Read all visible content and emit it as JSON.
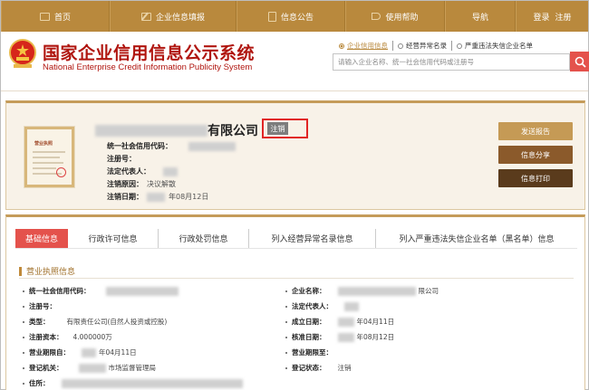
{
  "nav": {
    "home": "首页",
    "report": "企业信息填报",
    "notice": "信息公告",
    "help": "使用帮助",
    "guide": "导航",
    "login": "登录",
    "register": "注册"
  },
  "header": {
    "title_cn": "国家企业信用信息公示系统",
    "title_en": "National Enterprise Credit Information Publicity System",
    "links": {
      "enterprise_info": "企业信用信息",
      "abnormal_list": "经营异常名录",
      "blacklist": "严重违法失信企业名单"
    },
    "search_placeholder": "请输入企业名称、统一社会信用代码或注册号"
  },
  "company": {
    "name_suffix": "有限公司",
    "status": "注销",
    "license_title": "营业执照",
    "fields": {
      "credit_code_label": "统一社会信用代码：",
      "reg_no_label": "注册号：",
      "legal_rep_label": "法定代表人：",
      "cancel_reason_label": "注销原因：",
      "cancel_reason_value": "决议解散",
      "cancel_date_label": "注销日期：",
      "cancel_date_value": "年08月12日"
    },
    "buttons": {
      "send_report": "发送报告",
      "share": "信息分享",
      "print": "信息打印"
    }
  },
  "tabs": [
    {
      "label": "基础信息",
      "active": true
    },
    {
      "label": "行政许可信息"
    },
    {
      "label": "行政处罚信息"
    },
    {
      "label": "列入经营异常名录信息"
    },
    {
      "label": "列入严重违法失信企业名单（黑名单）信息"
    }
  ],
  "license_section": {
    "title": "营业执照信息",
    "left": [
      {
        "label": "统一社会信用代码：",
        "value": ""
      },
      {
        "label": "注册号：",
        "value": ""
      },
      {
        "label": "类型：",
        "value": "有限责任公司(自然人投资或控股)"
      },
      {
        "label": "注册资本：",
        "value": "4.000000万"
      },
      {
        "label": "营业期限自：",
        "value": "年04月11日"
      },
      {
        "label": "登记机关：",
        "value": "市场监督管理局"
      },
      {
        "label": "住所：",
        "value": ""
      }
    ],
    "right": [
      {
        "label": "企业名称：",
        "value": "限公司"
      },
      {
        "label": "法定代表人：",
        "value": ""
      },
      {
        "label": "成立日期：",
        "value": "年04月11日"
      },
      {
        "label": "核准日期：",
        "value": "年08月12日"
      },
      {
        "label": "营业期限至：",
        "value": ""
      },
      {
        "label": "登记状态：",
        "value": "注销"
      }
    ]
  },
  "colors": {
    "nav_bg": "#b9893d",
    "brand_red": "#b0150f",
    "tab_active": "#e4524c",
    "btn_send": "#c59a55",
    "btn_share": "#8b5a2b",
    "btn_print": "#5a3b1c"
  }
}
